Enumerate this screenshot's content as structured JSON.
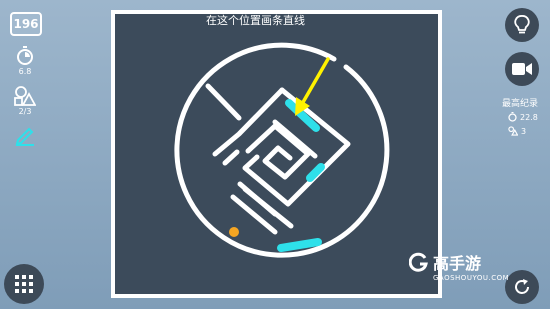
{
  "level": "196",
  "stats": {
    "time": "6.8",
    "shapes": "2/3"
  },
  "hint": "在这个位置画条直线",
  "record": {
    "title": "最高纪录",
    "time": "22.8",
    "shapes": "3"
  },
  "watermark": {
    "brand": "高手游",
    "url": "GAOSHOUYOU.COM"
  },
  "colors": {
    "board_bg": "#3c4b5b",
    "drawn_line": "#2ee0ea",
    "arrow": "#fff200",
    "ball": "#f5a623",
    "button_bg": "#3d4a58"
  }
}
